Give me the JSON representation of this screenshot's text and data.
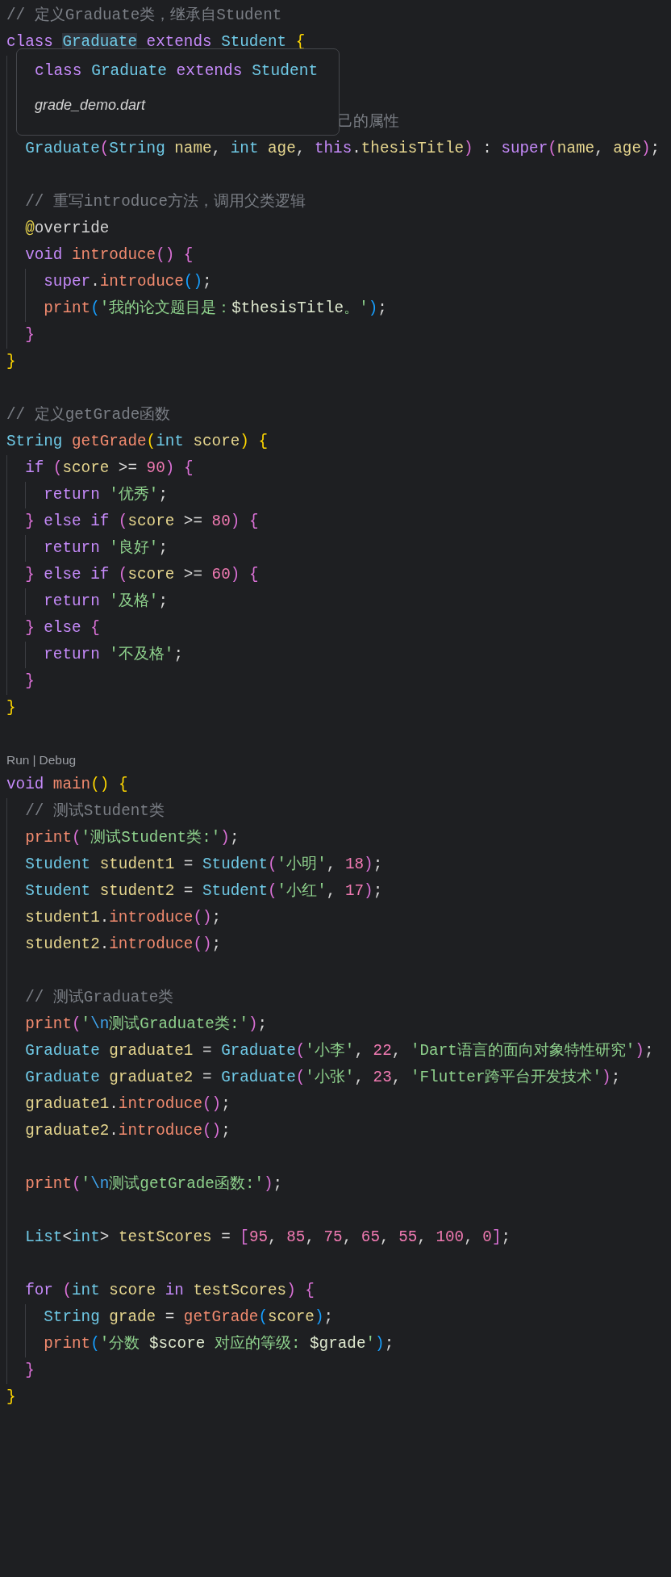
{
  "editor": {
    "lines": [
      {
        "kind": "code",
        "tokens": [
          {
            "text": "// 定义Graduate类，继承自Student",
            "kind": "comment"
          }
        ]
      },
      {
        "kind": "code",
        "tokens": [
          {
            "text": "class ",
            "kind": "keyword"
          },
          {
            "text": "Graduate",
            "kind": "type",
            "highlighted": true
          },
          {
            "text": " extends ",
            "kind": "keyword"
          },
          {
            "text": "Student ",
            "kind": "type"
          },
          {
            "text": "{",
            "kind": "bracket1"
          }
        ],
        "children": [
          {
            "kind": "blank"
          },
          {
            "kind": "blank"
          },
          {
            "kind": "partly_covered",
            "tokens": [
              {
                "text": "己的属性",
                "kind": "comment"
              }
            ]
          },
          {
            "kind": "code",
            "tokens": [
              {
                "text": "Graduate",
                "kind": "type"
              },
              {
                "text": "(",
                "kind": "bracket2"
              },
              {
                "text": "String ",
                "kind": "type"
              },
              {
                "text": "name",
                "kind": "var"
              },
              {
                "text": ", ",
                "kind": "plain"
              },
              {
                "text": "int ",
                "kind": "type"
              },
              {
                "text": "age",
                "kind": "var"
              },
              {
                "text": ", ",
                "kind": "plain"
              },
              {
                "text": "this",
                "kind": "keyword"
              },
              {
                "text": ".",
                "kind": "plain"
              },
              {
                "text": "thesisTitle",
                "kind": "var"
              },
              {
                "text": ")",
                "kind": "bracket2"
              },
              {
                "text": " : ",
                "kind": "plain"
              },
              {
                "text": "super",
                "kind": "keyword"
              },
              {
                "text": "(",
                "kind": "bracket2"
              },
              {
                "text": "name",
                "kind": "var"
              },
              {
                "text": ", ",
                "kind": "plain"
              },
              {
                "text": "age",
                "kind": "var"
              },
              {
                "text": ")",
                "kind": "bracket2"
              },
              {
                "text": ";",
                "kind": "plain"
              }
            ]
          },
          {
            "kind": "blank"
          },
          {
            "kind": "code",
            "tokens": [
              {
                "text": "// 重写introduce方法，调用父类逻辑",
                "kind": "comment"
              }
            ]
          },
          {
            "kind": "code",
            "tokens": [
              {
                "text": "@",
                "kind": "annotation"
              },
              {
                "text": "override",
                "kind": "plain"
              }
            ]
          },
          {
            "kind": "code",
            "tokens": [
              {
                "text": "void ",
                "kind": "keyword"
              },
              {
                "text": "introduce",
                "kind": "func"
              },
              {
                "text": "()",
                "kind": "bracket2"
              },
              {
                "text": " {",
                "kind": "bracket2"
              }
            ],
            "children": [
              {
                "kind": "code",
                "tokens": [
                  {
                    "text": "super",
                    "kind": "keyword"
                  },
                  {
                    "text": ".",
                    "kind": "plain"
                  },
                  {
                    "text": "introduce",
                    "kind": "func"
                  },
                  {
                    "text": "()",
                    "kind": "bracket3"
                  },
                  {
                    "text": ";",
                    "kind": "plain"
                  }
                ]
              },
              {
                "kind": "code",
                "tokens": [
                  {
                    "text": "print",
                    "kind": "func"
                  },
                  {
                    "text": "(",
                    "kind": "bracket3"
                  },
                  {
                    "text": "'我的论文题目是：",
                    "kind": "string"
                  },
                  {
                    "text": "$thesisTitle",
                    "kind": "interp"
                  },
                  {
                    "text": "。'",
                    "kind": "string"
                  },
                  {
                    "text": ")",
                    "kind": "bracket3"
                  },
                  {
                    "text": ";",
                    "kind": "plain"
                  }
                ]
              }
            ]
          },
          {
            "kind": "code",
            "tokens": [
              {
                "text": "}",
                "kind": "bracket2"
              }
            ]
          }
        ]
      },
      {
        "kind": "code",
        "tokens": [
          {
            "text": "}",
            "kind": "bracket1"
          }
        ]
      },
      {
        "kind": "blank"
      },
      {
        "kind": "code",
        "tokens": [
          {
            "text": "// 定义getGrade函数",
            "kind": "comment"
          }
        ]
      },
      {
        "kind": "code",
        "tokens": [
          {
            "text": "String ",
            "kind": "type"
          },
          {
            "text": "getGrade",
            "kind": "func"
          },
          {
            "text": "(",
            "kind": "bracket1"
          },
          {
            "text": "int ",
            "kind": "type"
          },
          {
            "text": "score",
            "kind": "var"
          },
          {
            "text": ")",
            "kind": "bracket1"
          },
          {
            "text": " {",
            "kind": "bracket1"
          }
        ],
        "children": [
          {
            "kind": "code",
            "tokens": [
              {
                "text": "if ",
                "kind": "keyword"
              },
              {
                "text": "(",
                "kind": "bracket2"
              },
              {
                "text": "score",
                "kind": "var"
              },
              {
                "text": " >= ",
                "kind": "plain"
              },
              {
                "text": "90",
                "kind": "number"
              },
              {
                "text": ")",
                "kind": "bracket2"
              },
              {
                "text": " {",
                "kind": "bracket2"
              }
            ],
            "children": [
              {
                "kind": "code",
                "tokens": [
                  {
                    "text": "return ",
                    "kind": "keyword"
                  },
                  {
                    "text": "'优秀'",
                    "kind": "string"
                  },
                  {
                    "text": ";",
                    "kind": "plain"
                  }
                ]
              }
            ]
          },
          {
            "kind": "code",
            "tokens": [
              {
                "text": "}",
                "kind": "bracket2"
              },
              {
                "text": " else if ",
                "kind": "keyword"
              },
              {
                "text": "(",
                "kind": "bracket2"
              },
              {
                "text": "score",
                "kind": "var"
              },
              {
                "text": " >= ",
                "kind": "plain"
              },
              {
                "text": "80",
                "kind": "number"
              },
              {
                "text": ")",
                "kind": "bracket2"
              },
              {
                "text": " {",
                "kind": "bracket2"
              }
            ],
            "children": [
              {
                "kind": "code",
                "tokens": [
                  {
                    "text": "return ",
                    "kind": "keyword"
                  },
                  {
                    "text": "'良好'",
                    "kind": "string"
                  },
                  {
                    "text": ";",
                    "kind": "plain"
                  }
                ]
              }
            ]
          },
          {
            "kind": "code",
            "tokens": [
              {
                "text": "}",
                "kind": "bracket2"
              },
              {
                "text": " else if ",
                "kind": "keyword"
              },
              {
                "text": "(",
                "kind": "bracket2"
              },
              {
                "text": "score",
                "kind": "var"
              },
              {
                "text": " >= ",
                "kind": "plain"
              },
              {
                "text": "60",
                "kind": "number"
              },
              {
                "text": ")",
                "kind": "bracket2"
              },
              {
                "text": " {",
                "kind": "bracket2"
              }
            ],
            "children": [
              {
                "kind": "code",
                "tokens": [
                  {
                    "text": "return ",
                    "kind": "keyword"
                  },
                  {
                    "text": "'及格'",
                    "kind": "string"
                  },
                  {
                    "text": ";",
                    "kind": "plain"
                  }
                ]
              }
            ]
          },
          {
            "kind": "code",
            "tokens": [
              {
                "text": "}",
                "kind": "bracket2"
              },
              {
                "text": " else ",
                "kind": "keyword"
              },
              {
                "text": "{",
                "kind": "bracket2"
              }
            ],
            "children": [
              {
                "kind": "code",
                "tokens": [
                  {
                    "text": "return ",
                    "kind": "keyword"
                  },
                  {
                    "text": "'不及格'",
                    "kind": "string"
                  },
                  {
                    "text": ";",
                    "kind": "plain"
                  }
                ]
              }
            ]
          },
          {
            "kind": "code",
            "tokens": [
              {
                "text": "}",
                "kind": "bracket2"
              }
            ]
          }
        ]
      },
      {
        "kind": "code",
        "tokens": [
          {
            "text": "}",
            "kind": "bracket1"
          }
        ]
      },
      {
        "kind": "blank"
      },
      {
        "kind": "codelens",
        "tokens": [
          {
            "text": "Run",
            "kind": "link"
          },
          {
            "text": "|",
            "kind": "separator"
          },
          {
            "text": "Debug",
            "kind": "link"
          }
        ]
      },
      {
        "kind": "code",
        "tokens": [
          {
            "text": "void ",
            "kind": "keyword"
          },
          {
            "text": "main",
            "kind": "func"
          },
          {
            "text": "()",
            "kind": "bracket1"
          },
          {
            "text": " {",
            "kind": "bracket1"
          }
        ],
        "children": [
          {
            "kind": "code",
            "tokens": [
              {
                "text": "// 测试Student类",
                "kind": "comment"
              }
            ]
          },
          {
            "kind": "code",
            "tokens": [
              {
                "text": "print",
                "kind": "func"
              },
              {
                "text": "(",
                "kind": "bracket2"
              },
              {
                "text": "'测试Student类:'",
                "kind": "string"
              },
              {
                "text": ")",
                "kind": "bracket2"
              },
              {
                "text": ";",
                "kind": "plain"
              }
            ]
          },
          {
            "kind": "code",
            "tokens": [
              {
                "text": "Student ",
                "kind": "type"
              },
              {
                "text": "student1",
                "kind": "var"
              },
              {
                "text": " = ",
                "kind": "plain"
              },
              {
                "text": "Student",
                "kind": "type"
              },
              {
                "text": "(",
                "kind": "bracket2"
              },
              {
                "text": "'小明'",
                "kind": "string"
              },
              {
                "text": ", ",
                "kind": "plain"
              },
              {
                "text": "18",
                "kind": "number"
              },
              {
                "text": ")",
                "kind": "bracket2"
              },
              {
                "text": ";",
                "kind": "plain"
              }
            ]
          },
          {
            "kind": "code",
            "tokens": [
              {
                "text": "Student ",
                "kind": "type"
              },
              {
                "text": "student2",
                "kind": "var"
              },
              {
                "text": " = ",
                "kind": "plain"
              },
              {
                "text": "Student",
                "kind": "type"
              },
              {
                "text": "(",
                "kind": "bracket2"
              },
              {
                "text": "'小红'",
                "kind": "string"
              },
              {
                "text": ", ",
                "kind": "plain"
              },
              {
                "text": "17",
                "kind": "number"
              },
              {
                "text": ")",
                "kind": "bracket2"
              },
              {
                "text": ";",
                "kind": "plain"
              }
            ]
          },
          {
            "kind": "code",
            "tokens": [
              {
                "text": "student1",
                "kind": "var"
              },
              {
                "text": ".",
                "kind": "plain"
              },
              {
                "text": "introduce",
                "kind": "func"
              },
              {
                "text": "()",
                "kind": "bracket2"
              },
              {
                "text": ";",
                "kind": "plain"
              }
            ]
          },
          {
            "kind": "code",
            "tokens": [
              {
                "text": "student2",
                "kind": "var"
              },
              {
                "text": ".",
                "kind": "plain"
              },
              {
                "text": "introduce",
                "kind": "func"
              },
              {
                "text": "()",
                "kind": "bracket2"
              },
              {
                "text": ";",
                "kind": "plain"
              }
            ]
          },
          {
            "kind": "blank"
          },
          {
            "kind": "code",
            "tokens": [
              {
                "text": "// 测试Graduate类",
                "kind": "comment"
              }
            ]
          },
          {
            "kind": "code",
            "tokens": [
              {
                "text": "print",
                "kind": "func"
              },
              {
                "text": "(",
                "kind": "bracket2"
              },
              {
                "text": "'",
                "kind": "string"
              },
              {
                "text": "\\n",
                "kind": "escape"
              },
              {
                "text": "测试Graduate类:'",
                "kind": "string"
              },
              {
                "text": ")",
                "kind": "bracket2"
              },
              {
                "text": ";",
                "kind": "plain"
              }
            ]
          },
          {
            "kind": "code",
            "tokens": [
              {
                "text": "Graduate ",
                "kind": "type"
              },
              {
                "text": "graduate1",
                "kind": "var"
              },
              {
                "text": " = ",
                "kind": "plain"
              },
              {
                "text": "Graduate",
                "kind": "type"
              },
              {
                "text": "(",
                "kind": "bracket2"
              },
              {
                "text": "'小李'",
                "kind": "string"
              },
              {
                "text": ", ",
                "kind": "plain"
              },
              {
                "text": "22",
                "kind": "number"
              },
              {
                "text": ", ",
                "kind": "plain"
              },
              {
                "text": "'Dart语言的面向对象特性研究'",
                "kind": "string"
              },
              {
                "text": ")",
                "kind": "bracket2"
              },
              {
                "text": ";",
                "kind": "plain"
              }
            ]
          },
          {
            "kind": "code",
            "tokens": [
              {
                "text": "Graduate ",
                "kind": "type"
              },
              {
                "text": "graduate2",
                "kind": "var"
              },
              {
                "text": " = ",
                "kind": "plain"
              },
              {
                "text": "Graduate",
                "kind": "type"
              },
              {
                "text": "(",
                "kind": "bracket2"
              },
              {
                "text": "'小张'",
                "kind": "string"
              },
              {
                "text": ", ",
                "kind": "plain"
              },
              {
                "text": "23",
                "kind": "number"
              },
              {
                "text": ", ",
                "kind": "plain"
              },
              {
                "text": "'Flutter跨平台开发技术'",
                "kind": "string"
              },
              {
                "text": ")",
                "kind": "bracket2"
              },
              {
                "text": ";",
                "kind": "plain"
              }
            ]
          },
          {
            "kind": "code",
            "tokens": [
              {
                "text": "graduate1",
                "kind": "var"
              },
              {
                "text": ".",
                "kind": "plain"
              },
              {
                "text": "introduce",
                "kind": "func"
              },
              {
                "text": "()",
                "kind": "bracket2"
              },
              {
                "text": ";",
                "kind": "plain"
              }
            ]
          },
          {
            "kind": "code",
            "tokens": [
              {
                "text": "graduate2",
                "kind": "var"
              },
              {
                "text": ".",
                "kind": "plain"
              },
              {
                "text": "introduce",
                "kind": "func"
              },
              {
                "text": "()",
                "kind": "bracket2"
              },
              {
                "text": ";",
                "kind": "plain"
              }
            ]
          },
          {
            "kind": "blank"
          },
          {
            "kind": "code",
            "tokens": [
              {
                "text": "print",
                "kind": "func"
              },
              {
                "text": "(",
                "kind": "bracket2"
              },
              {
                "text": "'",
                "kind": "string"
              },
              {
                "text": "\\n",
                "kind": "escape"
              },
              {
                "text": "测试getGrade函数:'",
                "kind": "string"
              },
              {
                "text": ")",
                "kind": "bracket2"
              },
              {
                "text": ";",
                "kind": "plain"
              }
            ]
          },
          {
            "kind": "blank"
          },
          {
            "kind": "code",
            "tokens": [
              {
                "text": "List",
                "kind": "type"
              },
              {
                "text": "<",
                "kind": "plain"
              },
              {
                "text": "int",
                "kind": "type"
              },
              {
                "text": "> ",
                "kind": "plain"
              },
              {
                "text": "testScores",
                "kind": "var"
              },
              {
                "text": " = ",
                "kind": "plain"
              },
              {
                "text": "[",
                "kind": "bracket2"
              },
              {
                "text": "95",
                "kind": "number"
              },
              {
                "text": ", ",
                "kind": "plain"
              },
              {
                "text": "85",
                "kind": "number"
              },
              {
                "text": ", ",
                "kind": "plain"
              },
              {
                "text": "75",
                "kind": "number"
              },
              {
                "text": ", ",
                "kind": "plain"
              },
              {
                "text": "65",
                "kind": "number"
              },
              {
                "text": ", ",
                "kind": "plain"
              },
              {
                "text": "55",
                "kind": "number"
              },
              {
                "text": ", ",
                "kind": "plain"
              },
              {
                "text": "100",
                "kind": "number"
              },
              {
                "text": ", ",
                "kind": "plain"
              },
              {
                "text": "0",
                "kind": "number"
              },
              {
                "text": "]",
                "kind": "bracket2"
              },
              {
                "text": ";",
                "kind": "plain"
              }
            ]
          },
          {
            "kind": "blank"
          },
          {
            "kind": "code",
            "tokens": [
              {
                "text": "for ",
                "kind": "keyword"
              },
              {
                "text": "(",
                "kind": "bracket2"
              },
              {
                "text": "int ",
                "kind": "type"
              },
              {
                "text": "score ",
                "kind": "var"
              },
              {
                "text": "in ",
                "kind": "keyword"
              },
              {
                "text": "testScores",
                "kind": "var"
              },
              {
                "text": ")",
                "kind": "bracket2"
              },
              {
                "text": " {",
                "kind": "bracket2"
              }
            ],
            "children": [
              {
                "kind": "code",
                "tokens": [
                  {
                    "text": "String ",
                    "kind": "type"
                  },
                  {
                    "text": "grade",
                    "kind": "var"
                  },
                  {
                    "text": " = ",
                    "kind": "plain"
                  },
                  {
                    "text": "getGrade",
                    "kind": "func"
                  },
                  {
                    "text": "(",
                    "kind": "bracket3"
                  },
                  {
                    "text": "score",
                    "kind": "var"
                  },
                  {
                    "text": ")",
                    "kind": "bracket3"
                  },
                  {
                    "text": ";",
                    "kind": "plain"
                  }
                ]
              },
              {
                "kind": "code",
                "tokens": [
                  {
                    "text": "print",
                    "kind": "func"
                  },
                  {
                    "text": "(",
                    "kind": "bracket3"
                  },
                  {
                    "text": "'分数 ",
                    "kind": "string"
                  },
                  {
                    "text": "$score",
                    "kind": "interp"
                  },
                  {
                    "text": " 对应的等级: ",
                    "kind": "string"
                  },
                  {
                    "text": "$grade",
                    "kind": "interp"
                  },
                  {
                    "text": "'",
                    "kind": "string"
                  },
                  {
                    "text": ")",
                    "kind": "bracket3"
                  },
                  {
                    "text": ";",
                    "kind": "plain"
                  }
                ]
              }
            ]
          },
          {
            "kind": "code",
            "tokens": [
              {
                "text": "}",
                "kind": "bracket2"
              }
            ]
          }
        ]
      },
      {
        "kind": "code",
        "tokens": [
          {
            "text": "}",
            "kind": "bracket1"
          }
        ]
      }
    ]
  },
  "hover_tooltip": {
    "signature": [
      {
        "text": "class ",
        "kind": "keyword"
      },
      {
        "text": "Graduate ",
        "kind": "type"
      },
      {
        "text": "extends ",
        "kind": "keyword"
      },
      {
        "text": "Student",
        "kind": "type"
      }
    ],
    "file": "grade_demo.dart"
  }
}
